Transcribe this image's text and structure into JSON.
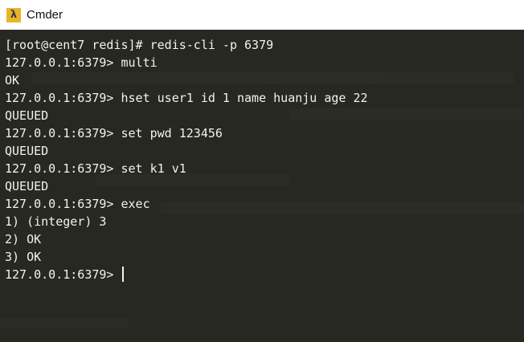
{
  "window": {
    "title": "Cmder",
    "icon": "lambda-icon",
    "icon_glyph": "λ",
    "icon_color": "#e9b42b"
  },
  "terminal": {
    "background": "#272822",
    "foreground": "#f2f2ee",
    "lines": [
      "[root@cent7 redis]# redis-cli -p 6379",
      "127.0.0.1:6379> multi",
      "OK",
      "127.0.0.1:6379> hset user1 id 1 name huanju age 22",
      "QUEUED",
      "127.0.0.1:6379> set pwd 123456",
      "QUEUED",
      "127.0.0.1:6379> set k1 v1",
      "QUEUED",
      "127.0.0.1:6379> exec",
      "1) (integer) 3",
      "2) OK",
      "3) OK"
    ],
    "prompt": "127.0.0.1:6379> "
  }
}
